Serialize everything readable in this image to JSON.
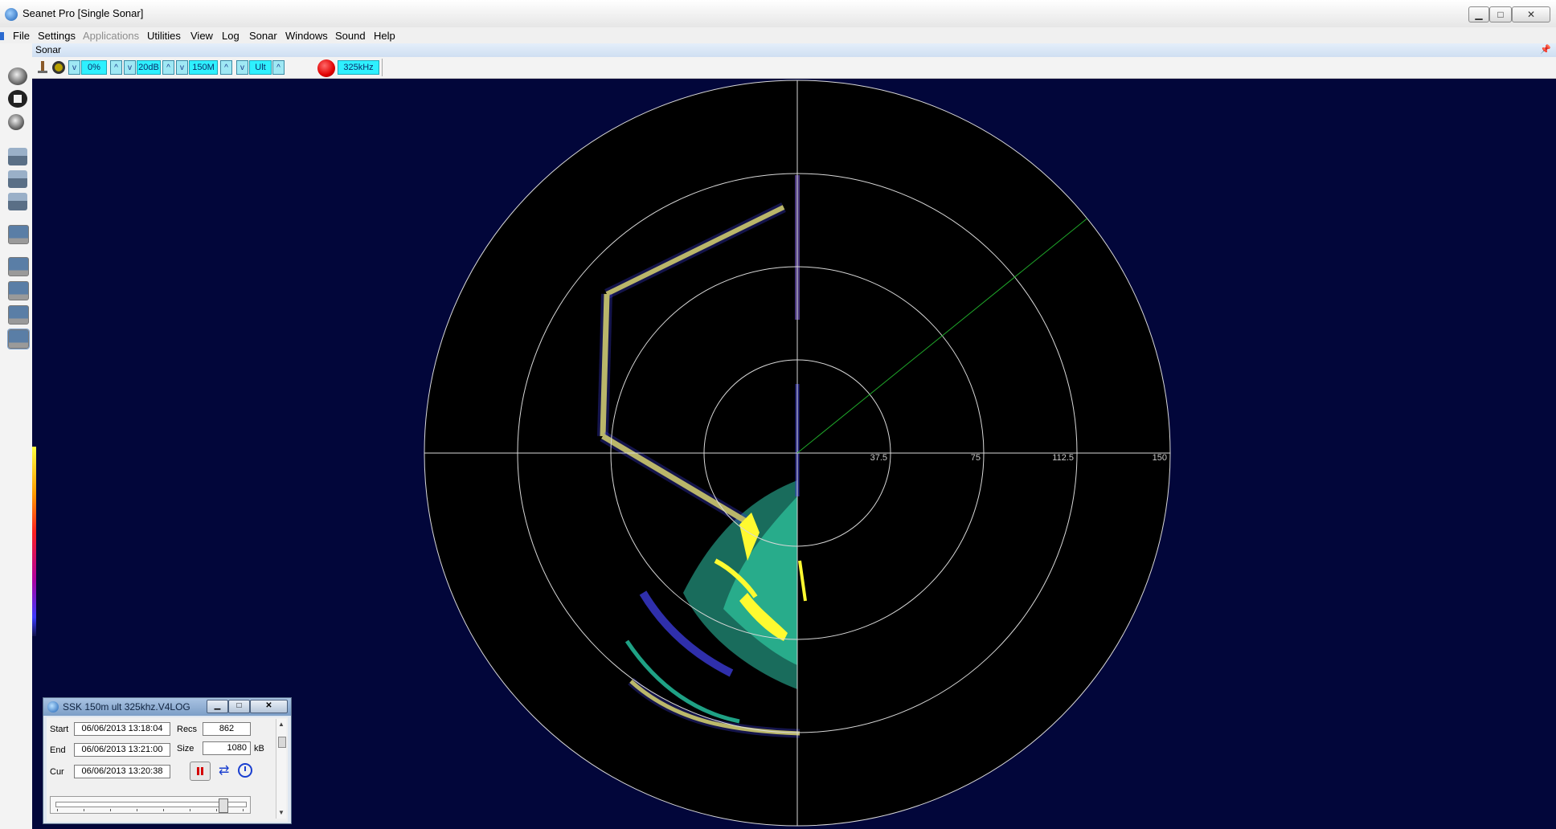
{
  "window": {
    "title": "Seanet Pro [Single Sonar]",
    "min_label": "▁",
    "max_label": "□",
    "close_label": "✕"
  },
  "menu": [
    "File",
    "Settings",
    "Applications",
    "Utilities",
    "View",
    "Log",
    "Sonar",
    "Windows",
    "Sound",
    "Help"
  ],
  "menu_disabled": [
    "Applications"
  ],
  "sonar_pane": {
    "title": "Sonar",
    "pin_glyph": "📌"
  },
  "toolbar": {
    "gain": "0%",
    "db": "20dB",
    "range": "150M",
    "resolution": "Ult",
    "frequency": "325kHz",
    "up_glyph": "^",
    "down_glyph": "v"
  },
  "left_tools": [
    "gear-icon",
    "stop-icon",
    "settings-icon",
    "printer-icon",
    "printer-icon",
    "printer-icon",
    "display-icon",
    "monitor-icon",
    "monitor-icon",
    "monitor-icon",
    "monitor-icon"
  ],
  "sonar_display": {
    "range_labels": [
      "37.5",
      "75",
      "112.5",
      "150"
    ],
    "ring_count": 4,
    "max_range_m": 150,
    "scan_heading_deg": 51,
    "colors": {
      "background": "#02063a",
      "plot": "#000000",
      "rings": "#d8d8d8",
      "scan_line": "#1fa82a",
      "echo_high": "#fffa30",
      "echo_mid": "#27c9a6",
      "echo_low": "#3b3bd6"
    }
  },
  "replay": {
    "title": "SSK 150m ult 325khz.V4LOG",
    "start_label": "Start",
    "start_value": "06/06/2013 13:18:04",
    "end_label": "End",
    "end_value": "06/06/2013 13:21:00",
    "cur_label": "Cur",
    "cur_value": "06/06/2013 13:20:38",
    "recs_label": "Recs",
    "recs_value": "862",
    "size_label": "Size",
    "size_value": "1080",
    "size_unit": "kB",
    "progress_fraction": 0.875,
    "scroll_up": "▲",
    "scroll_down": "▼",
    "loop_glyph": "⇄"
  }
}
